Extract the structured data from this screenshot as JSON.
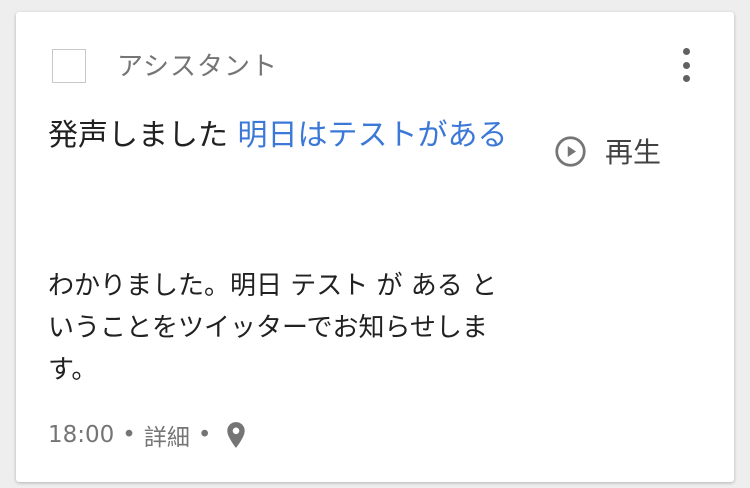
{
  "card": {
    "source": "アシスタント",
    "title_prefix": "発声しました",
    "title_query": "明日はテストがある",
    "play_label": "再生",
    "reply_text": "わかりました。明日 テスト が ある ということをツイッターでお知らせします。",
    "time": "18:00",
    "separator": "•",
    "details_label": "詳細"
  },
  "icons": {
    "more": "more-vert-icon",
    "play": "play-circle-icon",
    "location": "location-pin-icon"
  },
  "colors": {
    "query": "#3b78d8",
    "secondary_text": "#757575"
  }
}
